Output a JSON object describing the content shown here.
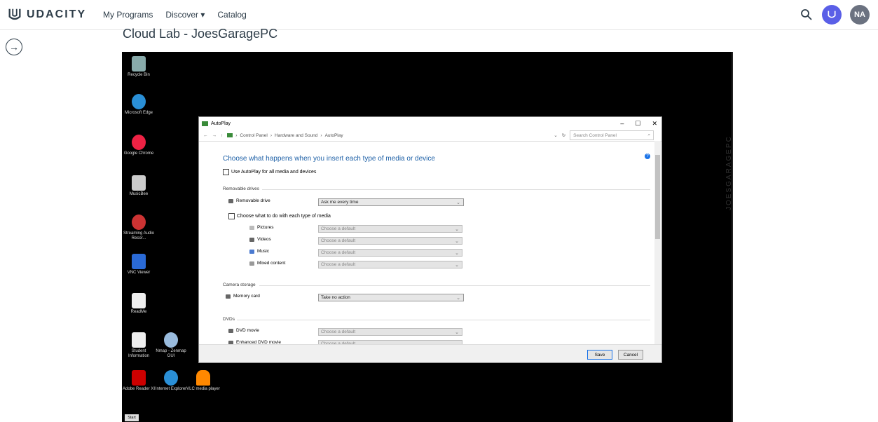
{
  "nav": {
    "logo_text": "UDACITY",
    "items": [
      "My Programs",
      "Discover ▾",
      "Catalog"
    ],
    "avatar_initials": "NA",
    "accent": "#5a5fe7"
  },
  "page": {
    "title": "Cloud Lab - JoesGaragePC",
    "side_label": "JOESGARAGEPC"
  },
  "desktop": {
    "icons": [
      {
        "label": "Recycle Bin",
        "color": "#8aa"
      },
      {
        "label": "Microsoft Edge",
        "color": "#2a8fd6"
      },
      {
        "label": "Google Chrome",
        "color": "#e24"
      },
      {
        "label": "MusicBee",
        "color": "#ccc"
      },
      {
        "label": "Streaming Audio Recor...",
        "color": "#c33"
      },
      {
        "label": "VNC Viewer",
        "color": "#2a6ad6"
      },
      {
        "label": "ReadMe",
        "color": "#eee"
      },
      {
        "label": "Student Information",
        "color": "#eee"
      },
      {
        "label": "Nmap - Zenmap GUI",
        "color": "#9bd"
      },
      {
        "label": "Adobe Reader XI",
        "color": "#c00"
      },
      {
        "label": "Internet Explorer",
        "color": "#2a8fd6"
      },
      {
        "label": "VLC media player",
        "color": "#f80"
      }
    ],
    "start_label": "Start"
  },
  "autoplay": {
    "window_title": "AutoPlay",
    "breadcrumb": [
      "Control Panel",
      "Hardware and Sound",
      "AutoPlay"
    ],
    "search_placeholder": "Search Control Panel",
    "heading": "Choose what happens when you insert each type of media or device",
    "use_autoplay_label": "Use AutoPlay for all media and devices",
    "removable_section": "Removable drives",
    "removable_drive_label": "Removable drive",
    "removable_drive_value": "Ask me every time",
    "choose_each_label": "Choose what to do with each type of media",
    "media": [
      {
        "label": "Pictures",
        "value": "Choose a default"
      },
      {
        "label": "Videos",
        "value": "Choose a default"
      },
      {
        "label": "Music",
        "value": "Choose a default"
      },
      {
        "label": "Mixed content",
        "value": "Choose a default"
      }
    ],
    "camera_section": "Camera storage",
    "memory_card_label": "Memory card",
    "memory_card_value": "Take no action",
    "dvd_section": "DVDs",
    "dvd_items": [
      {
        "label": "DVD movie",
        "value": "Choose a default"
      },
      {
        "label": "Enhanced DVD movie",
        "value": "Choose a default"
      }
    ],
    "save_label": "Save",
    "cancel_label": "Cancel"
  }
}
